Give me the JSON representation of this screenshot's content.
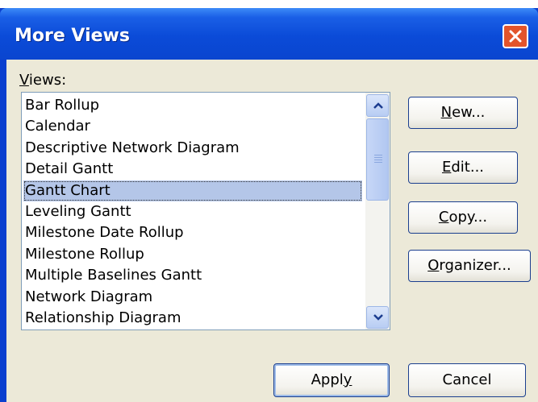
{
  "window": {
    "title": "More Views"
  },
  "views_label": {
    "accel": "V",
    "rest": "iews:"
  },
  "views": [
    {
      "label": "Bar Rollup",
      "selected": false
    },
    {
      "label": "Calendar",
      "selected": false
    },
    {
      "label": "Descriptive Network Diagram",
      "selected": false
    },
    {
      "label": "Detail Gantt",
      "selected": false
    },
    {
      "label": "Gantt Chart",
      "selected": true
    },
    {
      "label": "Leveling Gantt",
      "selected": false
    },
    {
      "label": "Milestone Date Rollup",
      "selected": false
    },
    {
      "label": "Milestone Rollup",
      "selected": false
    },
    {
      "label": "Multiple Baselines Gantt",
      "selected": false
    },
    {
      "label": "Network Diagram",
      "selected": false
    },
    {
      "label": "Relationship Diagram",
      "selected": false
    }
  ],
  "buttons": {
    "new": {
      "accel": "N",
      "rest": "ew..."
    },
    "edit": {
      "accel": "E",
      "rest": "dit..."
    },
    "copy": {
      "accel": "C",
      "rest": "opy..."
    },
    "organizer": {
      "accel": "O",
      "rest": "rganizer..."
    },
    "apply": {
      "pre": "Appl",
      "accel": "y"
    },
    "cancel": {
      "label": "Cancel"
    }
  },
  "icons": {
    "close": "close-icon",
    "scroll_up": "chevron-up-icon",
    "scroll_down": "chevron-down-icon"
  },
  "colors": {
    "titlebar": "#0a45cf",
    "face": "#ece9d8",
    "selection": "#b4c6e8",
    "close": "#e3542b"
  }
}
